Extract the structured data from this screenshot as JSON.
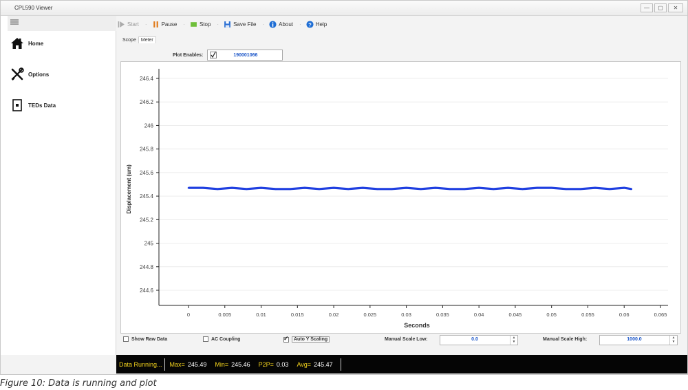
{
  "window": {
    "title": "CPL590 Viewer",
    "controls": {
      "minimize": "—",
      "restore": "▢",
      "close": "✕"
    }
  },
  "sidebar": {
    "items": [
      {
        "label": "Home",
        "icon": "home-icon"
      },
      {
        "label": "Options",
        "icon": "tools-icon"
      },
      {
        "label": "TEDs Data",
        "icon": "chip-icon"
      }
    ]
  },
  "toolbar": {
    "start": "Start",
    "pause": "Pause",
    "stop": "Stop",
    "save": "Save File",
    "about": "About",
    "help": "Help",
    "separator": "·"
  },
  "tabs": [
    {
      "label": "Scope",
      "active": false
    },
    {
      "label": "Meter",
      "active": true
    }
  ],
  "plot_enables": {
    "label": "Plot Enables:",
    "checked": true,
    "value": "190001066"
  },
  "chart_data": {
    "type": "line",
    "xlabel": "Seconds",
    "ylabel": "Displacement (um)",
    "xlim": [
      -0.005,
      0.065
    ],
    "ylim": [
      244.5,
      245.5
    ],
    "x_ticks": [
      "0",
      "0.005",
      "0.01",
      "0.015",
      "0.02",
      "0.025",
      "0.03",
      "0.035",
      "0.04",
      "0.045",
      "0.05",
      "0.055",
      "0.06",
      "0.065"
    ],
    "y_ticks": [
      "244.6",
      "244.8",
      "245",
      "245.2",
      "245.4",
      "245.6",
      "245.8",
      "246",
      "246.2",
      "246.4"
    ],
    "grid": true,
    "series_color": "#1f3fe0",
    "series": [
      {
        "x": [
          0,
          0.002,
          0.004,
          0.006,
          0.008,
          0.01,
          0.012,
          0.014,
          0.016,
          0.018,
          0.02,
          0.022,
          0.024,
          0.026,
          0.028,
          0.03,
          0.032,
          0.034,
          0.036,
          0.038,
          0.04,
          0.042,
          0.044,
          0.046,
          0.048,
          0.05,
          0.052,
          0.054,
          0.056,
          0.058,
          0.06,
          0.061
        ],
        "values": [
          245.47,
          245.47,
          245.46,
          245.47,
          245.46,
          245.47,
          245.46,
          245.46,
          245.47,
          245.46,
          245.47,
          245.46,
          245.47,
          245.46,
          245.46,
          245.47,
          245.46,
          245.47,
          245.46,
          245.46,
          245.47,
          245.46,
          245.47,
          245.46,
          245.47,
          245.47,
          245.46,
          245.46,
          245.47,
          245.46,
          245.47,
          245.46
        ]
      }
    ]
  },
  "controls": {
    "show_raw": {
      "label": "Show Raw Data",
      "checked": false
    },
    "ac_coupling": {
      "label": "AC Coupling",
      "checked": false
    },
    "auto_y": {
      "label": "Auto Y Scaling",
      "checked": true
    },
    "scale_low_label": "Manual Scale Low:",
    "scale_low_value": "0.0",
    "scale_high_label": "Manual Scale High:",
    "scale_high_value": "1000.0"
  },
  "status": {
    "running": "Data Running...",
    "max_label": "Max=",
    "max": "245.49",
    "min_label": "Min=",
    "min": "245.46",
    "p2p_label": "P2P=",
    "p2p": "0.03",
    "avg_label": "Avg=",
    "avg": "245.47"
  },
  "caption": "Figure 10: Data is running and plot"
}
